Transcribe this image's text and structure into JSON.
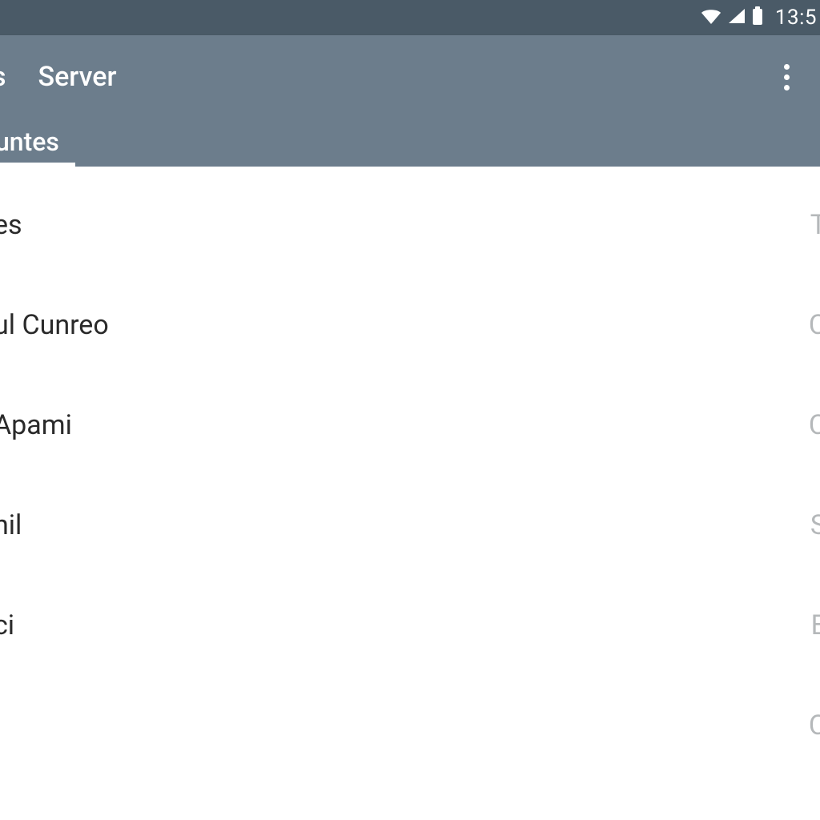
{
  "status": {
    "time": "13:5"
  },
  "appBar": {
    "leftFragment": "s",
    "title": "Server"
  },
  "tabs": {
    "active": "untes"
  },
  "list": [
    {
      "primary": "es",
      "secondary": "T"
    },
    {
      "primary": "ul Cunreo",
      "secondary": "C"
    },
    {
      "primary": "Apami",
      "secondary": "C"
    },
    {
      "primary": "nil",
      "secondary": "S"
    },
    {
      "primary": "ci",
      "secondary": "E"
    },
    {
      "primary": "",
      "secondary": "C"
    }
  ]
}
